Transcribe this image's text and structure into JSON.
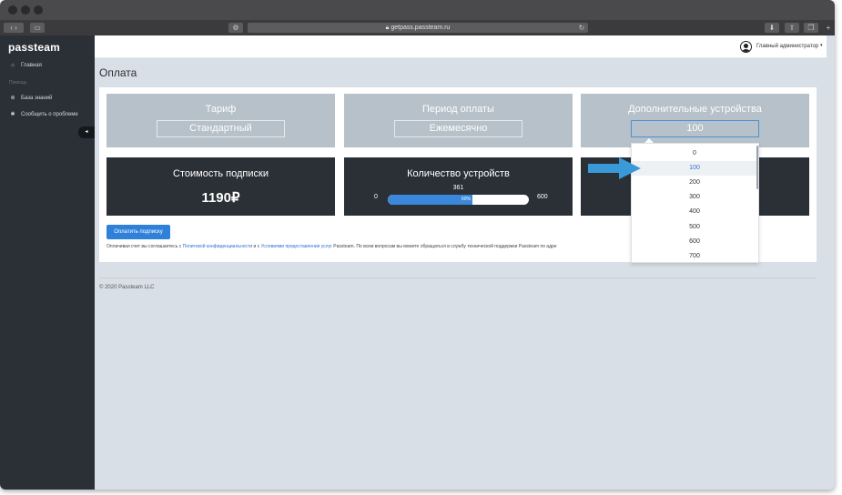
{
  "browser": {
    "url": "getpass.passteam.ru"
  },
  "sidebar": {
    "logo": "passteam",
    "items": [
      {
        "icon": "home-icon",
        "label": "Главная"
      },
      {
        "icon": "plus-icon",
        "label": "База знаний"
      },
      {
        "icon": "bug-icon",
        "label": "Сообщить о проблеме"
      }
    ],
    "section_label": "Помощь"
  },
  "topbar": {
    "user_name": "Главный администратор"
  },
  "page": {
    "title": "Оплата"
  },
  "cards": {
    "tariff": {
      "title": "Тариф",
      "value": "Стандартный"
    },
    "period": {
      "title": "Период оплаты",
      "value": "Ежемесячно"
    },
    "extra_devices": {
      "title": "Дополнительные устройства",
      "value": "100"
    },
    "cost": {
      "title": "Стоимость подписки",
      "value": "1190₽"
    },
    "devices": {
      "title": "Количество устройств",
      "count": "361",
      "min": "0",
      "max": "600",
      "percent_label": "60%",
      "fill_fraction": 0.6
    }
  },
  "pay_button": "Оплатить подписку",
  "legal": {
    "prefix": "Оплачивая счет вы соглашаетесь с ",
    "privacy_link": "Политикой конфиденциальности",
    "middle": " и с ",
    "terms_link": "Условиями предоставления услуг",
    "suffix": " Passteam. По всем вопросам вы можете обращаться в службу технической поддержки Passteam по адре"
  },
  "footer": {
    "copyright": "© 2020 Passteam LLC"
  },
  "dropdown": {
    "options": [
      "0",
      "100",
      "200",
      "300",
      "400",
      "500",
      "600",
      "700"
    ],
    "selected": "100"
  },
  "colors": {
    "accent": "#2f80d9",
    "sidebar_bg": "#2b3037",
    "card_light": "#b6c1c9",
    "arrow": "#3a9ad9"
  }
}
